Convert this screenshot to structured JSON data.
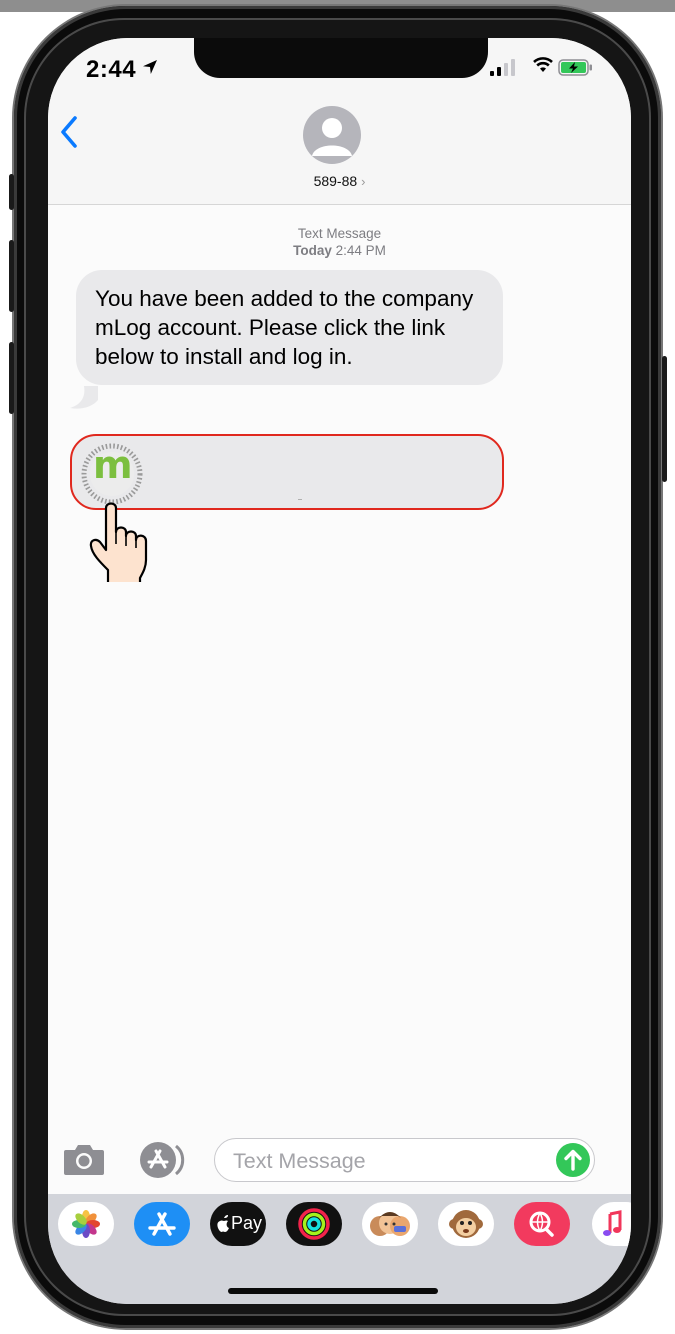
{
  "status_bar": {
    "time": "2:44"
  },
  "header": {
    "contact": "589-88",
    "chevron": "›"
  },
  "thread": {
    "meta_label": "Text Message",
    "meta_day": "Today",
    "meta_time": "2:44 PM",
    "message": "You have been added to the company mLog account. Please click the link below to install and log in.",
    "link_icon_letter": "m"
  },
  "composer": {
    "placeholder": "Text Message"
  },
  "app_drawer": {
    "items": [
      "photos-icon",
      "app-store-icon",
      "apple-pay-icon",
      "activity-icon",
      "memoji-icon",
      "animoji-icon",
      "web-search-icon",
      "music-icon"
    ],
    "apple_pay_label": "Pay"
  },
  "colors": {
    "accent_blue": "#0a7aff",
    "highlight_red": "#e0281e",
    "send_green": "#33c759",
    "mlog_green": "#7cbf3f"
  }
}
